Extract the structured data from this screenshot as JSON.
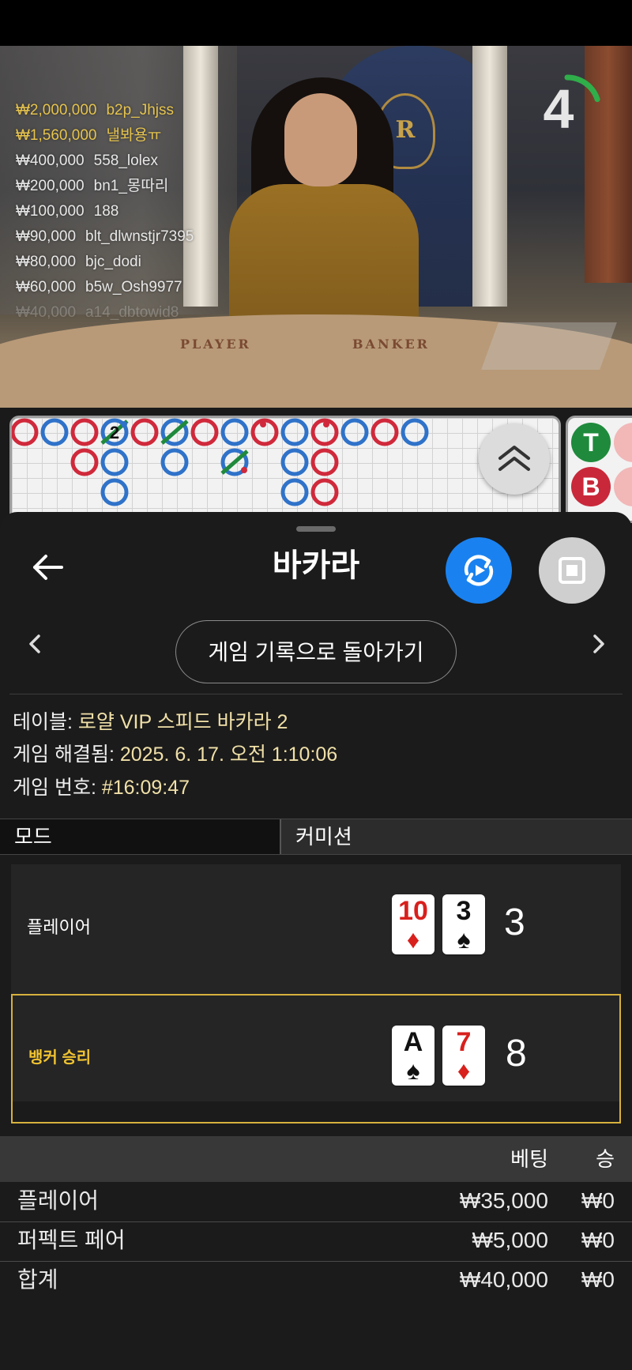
{
  "stream": {
    "countdown": "4",
    "countdown_progress": 0.2,
    "table_text_left": "PLAYER",
    "table_text_right": "BANKER",
    "emblem_letter": "R",
    "top_bets": [
      {
        "amount": "₩2,000,000",
        "user": "b2p_Jhjss",
        "color": "gold"
      },
      {
        "amount": "₩1,560,000",
        "user": "낼봐용ㅠ",
        "color": "gold"
      },
      {
        "amount": "₩400,000",
        "user": "558_lolex",
        "color": "white"
      },
      {
        "amount": "₩200,000",
        "user": "bn1_몽따리",
        "color": "white"
      },
      {
        "amount": "₩100,000",
        "user": "188",
        "color": "white"
      },
      {
        "amount": "₩90,000",
        "user": "blt_dlwnstjr7395",
        "color": "white"
      },
      {
        "amount": "₩80,000",
        "user": "bjc_dodi",
        "color": "white"
      },
      {
        "amount": "₩60,000",
        "user": "b5w_Osh9977",
        "color": "white"
      },
      {
        "amount": "₩40,000",
        "user": "a14_dbtowid8",
        "color": "white"
      }
    ]
  },
  "road": {
    "colors": {
      "banker": "#d0293b",
      "player": "#2f72c9",
      "tie": "#1f8a3c"
    },
    "overlay_number": "2",
    "side_chips": [
      "T",
      "B"
    ]
  },
  "sheet": {
    "title": "바카라",
    "return_button": "게임 기록으로 돌아가기",
    "info": {
      "table_label": "테이블: ",
      "table_value": "로얄 VIP 스피드 바카라 2",
      "resolved_label": "게임 해결됨: ",
      "resolved_value": "2025. 6. 17. 오전 1:10:06",
      "number_label": "게임 번호: ",
      "number_value": "#16:09:47"
    },
    "mode_tabs": {
      "mode": "모드",
      "commission": "커미션"
    },
    "result": {
      "player": {
        "label": "플레이어",
        "cards": [
          {
            "rank": "10",
            "suit": "♦",
            "color": "red"
          },
          {
            "rank": "3",
            "suit": "♠",
            "color": "black"
          }
        ],
        "score": "3"
      },
      "banker": {
        "label": "뱅커 승리",
        "cards": [
          {
            "rank": "A",
            "suit": "♠",
            "color": "black"
          },
          {
            "rank": "7",
            "suit": "♦",
            "color": "red"
          }
        ],
        "score": "8"
      }
    },
    "bets": {
      "header": {
        "bet": "베팅",
        "win": "승"
      },
      "rows": [
        {
          "name": "플레이어",
          "bet": "₩35,000",
          "win": "₩0"
        },
        {
          "name": "퍼펙트 페어",
          "bet": "₩5,000",
          "win": "₩0"
        },
        {
          "name": "합계",
          "bet": "₩40,000",
          "win": "₩0"
        }
      ]
    }
  }
}
